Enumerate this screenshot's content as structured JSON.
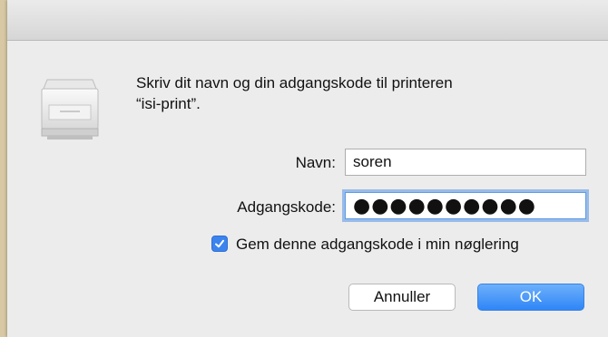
{
  "dialog": {
    "message_line1": "Skriv dit navn og din adgangskode til printeren",
    "message_line2": "“isi-print”.",
    "name_label": "Navn:",
    "name_value": "soren",
    "password_label": "Adgangskode:",
    "password_value": "●●●●●●●●●●",
    "remember_label": "Gem denne adgangskode i min nøglering",
    "remember_checked": true,
    "cancel_label": "Annuller",
    "ok_label": "OK"
  },
  "icons": {
    "printer": "printer-icon",
    "checkbox": "checkmark-icon"
  },
  "colors": {
    "accent": "#3b84ef",
    "focus_ring": "#5d9be5",
    "ok_button": "#2f86f7"
  }
}
